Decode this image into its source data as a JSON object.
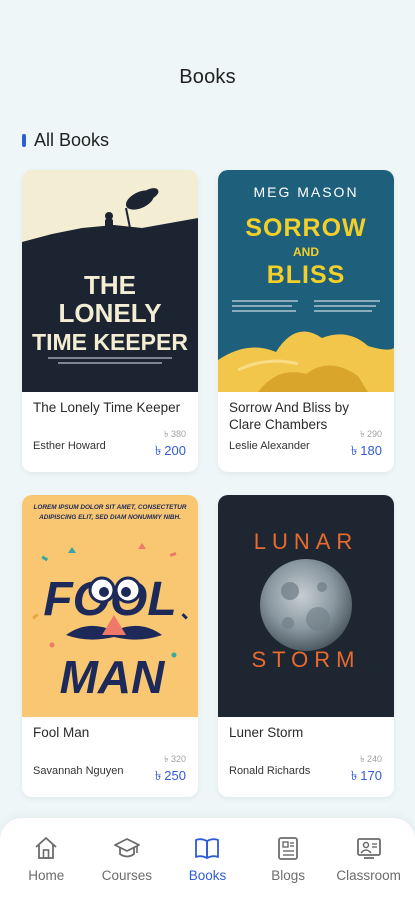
{
  "header": {
    "title": "Books"
  },
  "section": {
    "title": "All Books"
  },
  "books": [
    {
      "title": "The Lonely Time Keeper",
      "author": "Esther Howard",
      "old_price": "৳ 380",
      "price": "200",
      "currency": "৳",
      "cover": {
        "title_lines": [
          "THE",
          "LONELY",
          "TIME KEEPER"
        ],
        "colors": {
          "top": "#f3edd3",
          "bottom": "#1c2432",
          "text": "#f3edd3"
        }
      }
    },
    {
      "title": "Sorrow And Bliss by Clare Chambers",
      "author": "Leslie Alexander",
      "old_price": "৳ 290",
      "price": "180",
      "currency": "৳",
      "cover": {
        "author_text": "MEG MASON",
        "title_lines": [
          "SORROW",
          "AND",
          "BLISS"
        ],
        "colors": {
          "bg": "#1e607c",
          "text": "#f3cf2a",
          "fabric": "#f2c64b"
        }
      }
    },
    {
      "title": "Fool Man",
      "author": "Savannah Nguyen",
      "old_price": "৳ 320",
      "price": "250",
      "currency": "৳",
      "cover": {
        "tagline": [
          "LOREM IPSUM DOLOR SIT AMET, CONSECTETUR",
          "ADIPISCING ELIT, SED DIAM NONUMMY NIBH."
        ],
        "title_lines": [
          "FOOL",
          "MAN"
        ],
        "colors": {
          "bg": "#f9c771",
          "text": "#1d2a59",
          "nose": "#ee7869"
        }
      }
    },
    {
      "title": "Luner Storm",
      "author": "Ronald Richards",
      "old_price": "৳ 240",
      "price": "170",
      "currency": "৳",
      "cover": {
        "title_lines": [
          "LUNAR",
          "STORM"
        ],
        "colors": {
          "bg": "#1e2731",
          "text": "#e86a2e",
          "moon": "#8a98a1"
        }
      }
    }
  ],
  "nav": {
    "items": [
      {
        "label": "Home",
        "icon": "home-icon",
        "active": false
      },
      {
        "label": "Courses",
        "icon": "graduation-cap-icon",
        "active": false
      },
      {
        "label": "Books",
        "icon": "book-icon",
        "active": true
      },
      {
        "label": "Blogs",
        "icon": "blog-icon",
        "active": false
      },
      {
        "label": "Classroom",
        "icon": "classroom-icon",
        "active": false
      }
    ],
    "colors": {
      "active": "#2f5bd7",
      "inactive": "#6b6b6b"
    }
  }
}
